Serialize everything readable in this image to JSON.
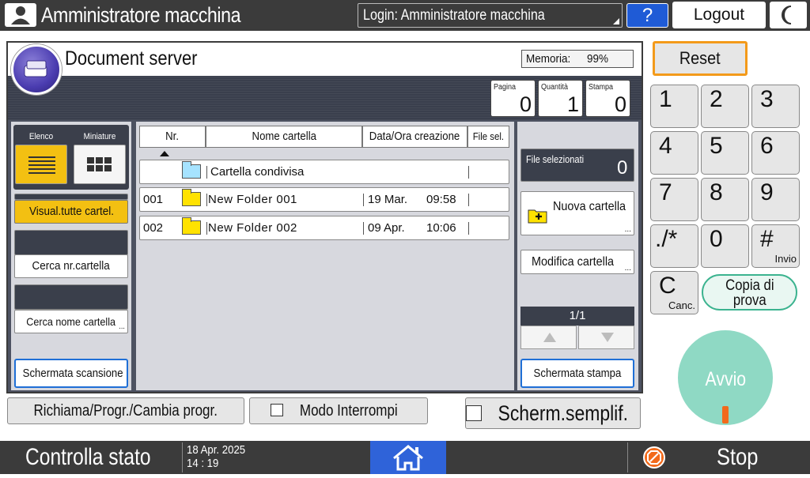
{
  "topbar": {
    "user_title": "Amministratore macchina",
    "login_label": "Login: Amministratore macchina",
    "help_label": "?",
    "logout_label": "Logout"
  },
  "main": {
    "title": "Document server",
    "memory_label": "Memoria:",
    "memory_value": "99%",
    "counters": [
      {
        "label": "Pagina",
        "value": "0"
      },
      {
        "label": "Quantità",
        "value": "1"
      },
      {
        "label": "Stampa",
        "value": "0"
      }
    ]
  },
  "left": {
    "view_list_label": "Elenco",
    "view_thumb_label": "Miniature",
    "show_all_label": "Visual.tutte cartel.",
    "search_number_label": "Cerca nr.cartella",
    "search_name_label": "Cerca nome cartella",
    "scan_screen_label": "Schermata scansione"
  },
  "table": {
    "headers": [
      "Nr.",
      "Nome cartella",
      "Data/Ora creazione",
      "File sel."
    ],
    "shared_folder": "Cartella condivisa",
    "rows": [
      {
        "nr": "001",
        "name": "New Folder 001",
        "date": "19 Mar.",
        "time": "09:58"
      },
      {
        "nr": "002",
        "name": "New Folder 002",
        "date": "09 Apr.",
        "time": "10:06"
      }
    ]
  },
  "right": {
    "selected_files_label": "File selezionati",
    "selected_files_value": "0",
    "new_folder_label": "Nuova cartella",
    "edit_folder_label": "Modifica cartella",
    "page_indicator": "1/1",
    "print_screen_label": "Schermata stampa"
  },
  "bottom": {
    "recall_label": "Richiama/Progr./Cambia progr.",
    "interrupt_label": "Modo Interrompi",
    "simple_screen_label": "Scherm.semplif."
  },
  "keypad": {
    "reset_label": "Reset",
    "keys": [
      "1",
      "2",
      "3",
      "4",
      "5",
      "6",
      "7",
      "8",
      "9",
      "./*",
      "0",
      "#"
    ],
    "enter_sub": "Invio",
    "clear_label": "C",
    "clear_sub": "Canc.",
    "sample_copy_line1": "Copia di",
    "sample_copy_line2": "prova",
    "start_label": "Avvio"
  },
  "statusbar": {
    "check_status_label": "Controlla stato",
    "date": "18 Apr. 2025",
    "time": "14 : 19",
    "stop_label": "Stop"
  },
  "colors": {
    "topbar": "#3b3b3b",
    "accent_blue": "#1f5bd6",
    "highlight_yellow": "#f3c012",
    "reset_orange": "#f39a1a",
    "start_green": "#8fd9c4"
  }
}
